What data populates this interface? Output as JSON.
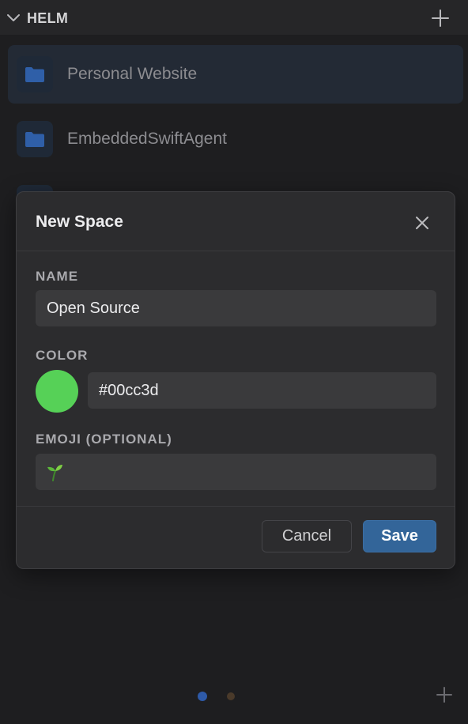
{
  "header": {
    "title": "HELM",
    "collapse_icon": "chevron-down-icon",
    "add_icon": "plus-icon"
  },
  "spaces": [
    {
      "label": "Personal Website",
      "icon": "folder-icon",
      "selected": true
    },
    {
      "label": "EmbeddedSwiftAgent",
      "icon": "folder-icon",
      "selected": false
    }
  ],
  "modal": {
    "title": "New Space",
    "close_icon": "close-icon",
    "name": {
      "label": "NAME",
      "value": "Open Source"
    },
    "color": {
      "label": "COLOR",
      "value": "#00cc3d",
      "swatch": "#56d157"
    },
    "emoji": {
      "label": "EMOJI (OPTIONAL)",
      "icon": "seedling-icon"
    },
    "cancel_label": "Cancel",
    "save_label": "Save"
  },
  "pager": {
    "pages": 2,
    "current": 1
  },
  "colors": {
    "accent": "#336599",
    "folder": "#2f5fa8",
    "background": "#1e1e20"
  }
}
